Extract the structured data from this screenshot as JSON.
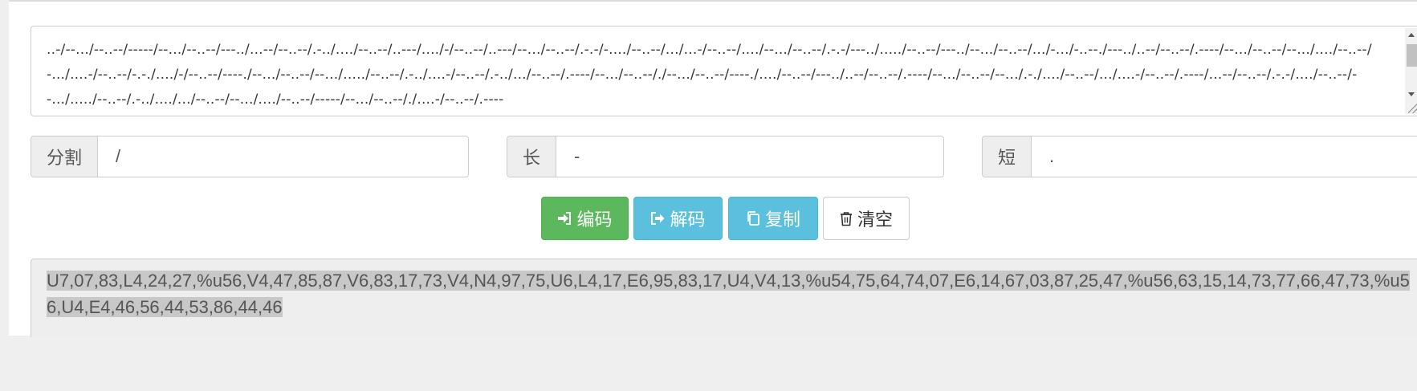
{
  "morse_input": {
    "value": "..-/--.../--..--/-----/--.../--..--/---../...--/--..--/.-../..../--..--/..---/..../-/--..--/..---/--.../--..--/.-.-/-..../--..--/.../...-/--..--/..../--.../--..--/.-.-/---../...../--..--/---../--.../--..--/.../-.../-..--./---../..--/--..--/.----/--.../--..--/--.../..../--..--/-.../....-/--..--/-.-./..../-/--..--/----./--.../--..--/--.../...../--..--/.-../....-/--..--/.-../.../--..--/.----/--.../--..--/./--.../--..--/----./..../--..--/---../..--/--..--/.----/--.../--..--/--.../.-./..../--..--/.../....-/--..--/.----/...--/--..--/.-.-/..../--..--/--.../...../--..--/.-../..../.../--..--/--.../..../--..--/-----/--.../--..--/./....-/--..--/.----"
  },
  "split_field": {
    "label": "分割",
    "value": "/"
  },
  "long_field": {
    "label": "长",
    "value": "-"
  },
  "short_field": {
    "label": "短",
    "value": "."
  },
  "buttons": {
    "encode": "编码",
    "decode": "解码",
    "copy": "复制",
    "clear": "清空"
  },
  "icons": {
    "encode": "sign-in-icon",
    "decode": "sign-out-icon",
    "copy": "copy-icon",
    "clear": "trash-icon"
  },
  "colors": {
    "success": "#5cb85c",
    "info": "#5bc0de"
  },
  "result": {
    "value": "U7,07,83,L4,24,27,%u56,V4,47,85,87,V6,83,17,73,V4,N4,97,75,U6,L4,17,E6,95,83,17,U4,V4,13,%u54,75,64,74,07,E6,14,67,03,87,25,47,%u56,63,15,14,73,77,66,47,73,%u56,U4,E4,46,56,44,53,86,44,46"
  }
}
